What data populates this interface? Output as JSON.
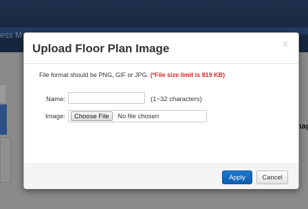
{
  "background": {
    "app_title_fragment": "ess M",
    "side_label_fragment": "nag"
  },
  "modal": {
    "title": "Upload Floor Plan Image",
    "close_glyph": "x",
    "note_text": "File format should be PNG, GIF or JPG. ",
    "note_warning": "(*File size limit is 819 KB)",
    "name_label": "Name:",
    "name_value": "",
    "name_hint": "(1~32 characters)",
    "image_label": "Image:",
    "choose_file_label": "Choose File",
    "file_status": "No file chosen",
    "apply_label": "Apply",
    "cancel_label": "Cancel"
  },
  "colors": {
    "primary_button": "#0b5fb0",
    "warning_text": "#e0242a"
  }
}
